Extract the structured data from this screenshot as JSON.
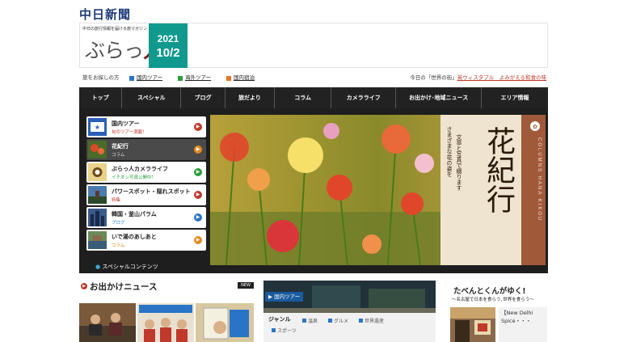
{
  "brand": {
    "newspaper": "中日新聞",
    "tagline": "中日の旅行情報を届ける旅マガジン",
    "magazine_main": "ぶらっ",
    "magazine_accent": "人",
    "year": "2021",
    "date": "10/2"
  },
  "subbar": {
    "label": "旅をお探しの方",
    "links": [
      {
        "label": "国内ツアー",
        "color": "#2a74c7"
      },
      {
        "label": "海外ツアー",
        "color": "#2a9e3a"
      },
      {
        "label": "国内宿泊",
        "color": "#e87722"
      }
    ],
    "today_prefix": "今日の「世界の街」",
    "today_link": "英ウィスタブル　よみがえる和食の味"
  },
  "nav": [
    "トップ",
    "スペシャル",
    "ブログ",
    "旅だより",
    "コラム",
    "カメラライフ",
    "お出かけ･地域ニュース",
    "エリア情報"
  ],
  "slider": {
    "tabs": [
      {
        "title": "国内ツアー",
        "sub": "旬のツアー満載！",
        "sub_color": "#c0392b",
        "arrow": "#c0392b",
        "selected": false
      },
      {
        "title": "花紀行",
        "sub": "コラム",
        "sub_color": "#dddddd",
        "arrow": "#e08a1e",
        "selected": true
      },
      {
        "title": "ぶらっ人カメラライフ",
        "sub": "イチオシ写真公開中！",
        "sub_color": "#2a9e3a",
        "arrow": "#2a9e3a",
        "selected": false
      },
      {
        "title": "パワースポット・隠れスポット",
        "sub": "特集",
        "sub_color": "#c0392b",
        "arrow": "#c0392b",
        "selected": false
      },
      {
        "title": "韓国・釜山パラム",
        "sub": "ブログ",
        "sub_color": "#2a74c7",
        "arrow": "#2a74c7",
        "selected": false
      },
      {
        "title": "いで湯のあしあと",
        "sub": "コラム",
        "sub_color": "#e08a1e",
        "arrow": "#e08a1e",
        "selected": false
      }
    ],
    "special_label": "スペシャルコンテンツ",
    "banner_side": "COLUMNS HANA KIKOU",
    "banner_sub1": "さまざまな花の姿を",
    "banner_sub2": "文章と写真で綴ります",
    "banner_title": "花紀行"
  },
  "news": {
    "title": "お出かけニュース",
    "badge": "NEW"
  },
  "tour": {
    "tab_label": "国内ツアー",
    "genre_label": "ジャンル",
    "genres": [
      "温泉",
      "グルメ",
      "世界遺産",
      "スポーツ"
    ]
  },
  "taben": {
    "title": "たべんとくんがゆく!",
    "subtitle": "〜名古屋で日本を食らう､世界を食らう〜",
    "caption": "【New Delhi Spice・・・"
  },
  "colors": {
    "date_bg": "#11998e",
    "nav_bg": "#222222",
    "stage_bg": "#1e1e1e"
  }
}
